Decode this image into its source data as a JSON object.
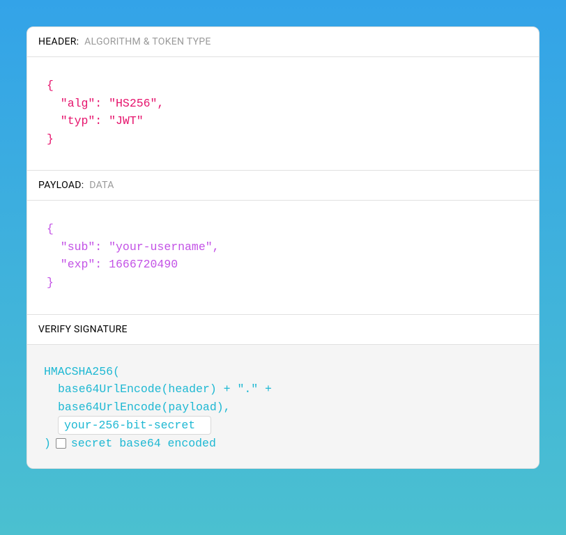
{
  "sections": {
    "header": {
      "label": "HEADER:",
      "sublabel": "ALGORITHM & TOKEN TYPE",
      "json_lines": [
        "{",
        "  \"alg\": \"HS256\",",
        "  \"typ\": \"JWT\"",
        "}"
      ]
    },
    "payload": {
      "label": "PAYLOAD:",
      "sublabel": "DATA",
      "json_lines": [
        "{",
        "  \"sub\": \"your-username\",",
        "  \"exp\": 1666720490",
        "}"
      ]
    },
    "signature": {
      "label": "VERIFY SIGNATURE",
      "line1": "HMACSHA256(",
      "line2": "base64UrlEncode(header) + \".\" +",
      "line3": "base64UrlEncode(payload),",
      "secret_value": "your-256-bit-secret",
      "close_paren": ")",
      "checkbox_label": "secret base64 encoded"
    }
  },
  "colors": {
    "header_json": "#e6136c",
    "payload_json": "#c352e6",
    "signature": "#1eb8d3"
  }
}
